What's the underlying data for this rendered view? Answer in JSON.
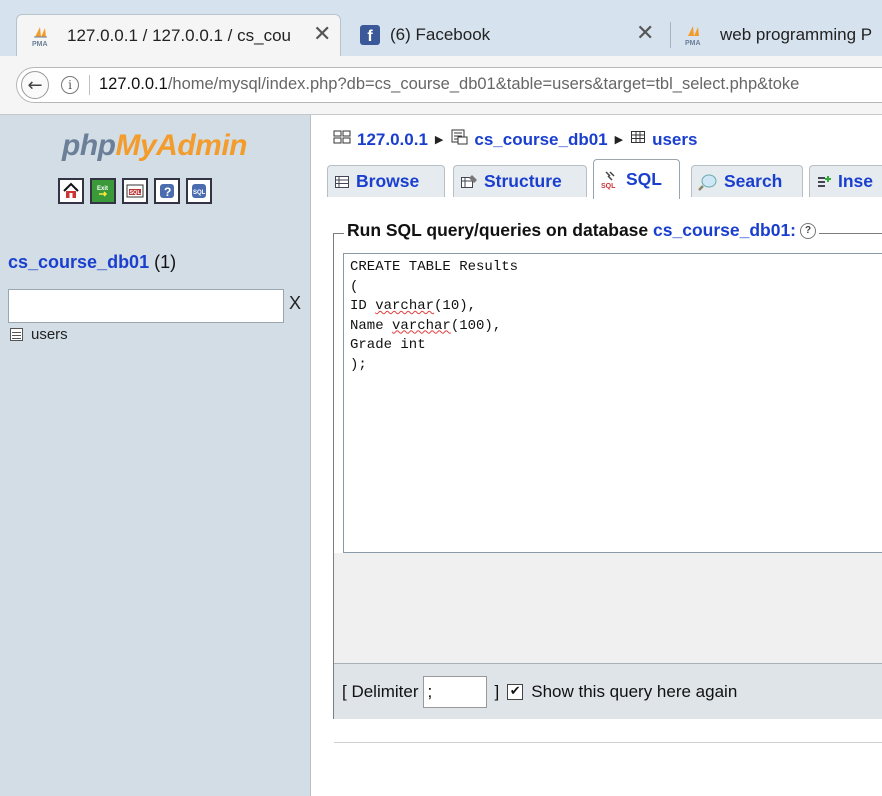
{
  "browser": {
    "tabs": [
      {
        "title": "127.0.0.1 / 127.0.0.1 / cs_cou",
        "favicon": "phpmyadmin-favicon",
        "active": true,
        "close": "✕"
      },
      {
        "title": "(6) Facebook",
        "favicon": "facebook-favicon",
        "active": false,
        "close": "✕"
      },
      {
        "title": "web programming P",
        "favicon": "phpmyadmin-favicon",
        "active": false
      }
    ],
    "url_host": "127.0.0.1",
    "url_path": "/home/mysql/index.php?db=cs_course_db01&table=users&target=tbl_select.php&toke"
  },
  "sidebar": {
    "logo_part1": "php",
    "logo_part2": "MyAdmin",
    "icons": [
      "home-icon",
      "exit-icon",
      "sql-query-icon",
      "docs-icon",
      "sql-docs-icon"
    ],
    "database": "cs_course_db01",
    "database_count": "(1)",
    "filter_value": "",
    "filter_clear": "X",
    "tables": [
      "users"
    ]
  },
  "main": {
    "breadcrumb": {
      "server": "127.0.0.1",
      "database": "cs_course_db01",
      "table": "users"
    },
    "tabs": [
      {
        "label": "Browse",
        "icon": "browse-icon"
      },
      {
        "label": "Structure",
        "icon": "structure-icon"
      },
      {
        "label": "SQL",
        "icon": "sql-icon",
        "active": true
      },
      {
        "label": "Search",
        "icon": "search-icon"
      },
      {
        "label": "Inse",
        "icon": "insert-icon"
      }
    ],
    "legend_prefix": "Run SQL query/queries on database ",
    "legend_db": "cs_course_db01:",
    "query_lines": [
      "CREATE TABLE Results",
      "(",
      "ID ",
      "varchar",
      "(10),",
      "Name ",
      "varchar",
      "(100),",
      "Grade int",
      ");"
    ],
    "delimiter_label_open": "[ Delimiter",
    "delimiter_value": ";",
    "delimiter_label_close": "]",
    "show_query_checked": true,
    "show_query_label": "Show this query here again"
  },
  "colors": {
    "link": "#1a3fcf",
    "sidebar_bg": "#d2dde6",
    "logo_orange": "#f39c2b",
    "logo_gray": "#6b7f98"
  }
}
